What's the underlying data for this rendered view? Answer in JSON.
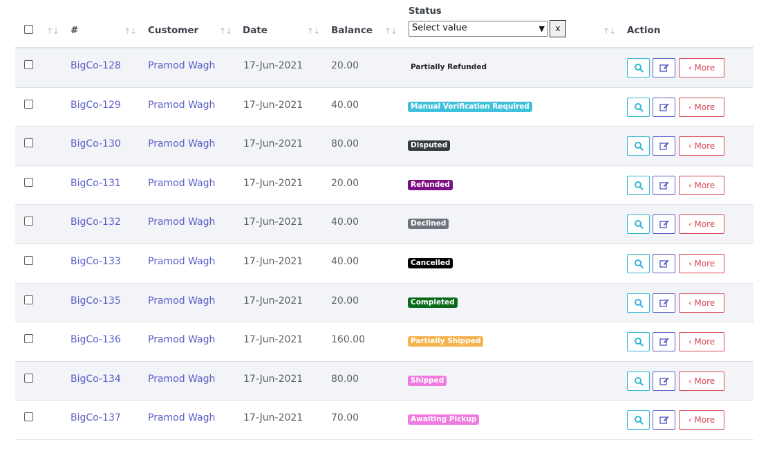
{
  "header": {
    "id_label": "#",
    "customer_label": "Customer",
    "date_label": "Date",
    "balance_label": "Balance",
    "status_label": "Status",
    "action_label": "Action",
    "status_filter_value": "Select value",
    "clear_label": "x",
    "sort_glyph": "↑↓"
  },
  "more_label": "‹ More",
  "rows": [
    {
      "id": "BigCo-128",
      "customer": "Pramod Wagh",
      "date": "17-Jun-2021",
      "balance": "20.00",
      "status": "Partially Refunded"
    },
    {
      "id": "BigCo-129",
      "customer": "Pramod Wagh",
      "date": "17-Jun-2021",
      "balance": "40.00",
      "status": "Manual Verification Required"
    },
    {
      "id": "BigCo-130",
      "customer": "Pramod Wagh",
      "date": "17-Jun-2021",
      "balance": "80.00",
      "status": "Disputed"
    },
    {
      "id": "BigCo-131",
      "customer": "Pramod Wagh",
      "date": "17-Jun-2021",
      "balance": "20.00",
      "status": "Refunded"
    },
    {
      "id": "BigCo-132",
      "customer": "Pramod Wagh",
      "date": "17-Jun-2021",
      "balance": "40.00",
      "status": "Declined"
    },
    {
      "id": "BigCo-133",
      "customer": "Pramod Wagh",
      "date": "17-Jun-2021",
      "balance": "40.00",
      "status": "Cancelled"
    },
    {
      "id": "BigCo-135",
      "customer": "Pramod Wagh",
      "date": "17-Jun-2021",
      "balance": "20.00",
      "status": "Completed"
    },
    {
      "id": "BigCo-136",
      "customer": "Pramod Wagh",
      "date": "17-Jun-2021",
      "balance": "160.00",
      "status": "Partially Shipped"
    },
    {
      "id": "BigCo-134",
      "customer": "Pramod Wagh",
      "date": "17-Jun-2021",
      "balance": "80.00",
      "status": "Shipped"
    },
    {
      "id": "BigCo-137",
      "customer": "Pramod Wagh",
      "date": "17-Jun-2021",
      "balance": "70.00",
      "status": "Awaiting Pickup"
    }
  ],
  "status_colors": {
    "Partially Refunded": {
      "bg": "transparent",
      "fg": "#222222"
    },
    "Manual Verification Required": {
      "bg": "#3fc1db",
      "fg": "#ffffff"
    },
    "Disputed": {
      "bg": "#343a40",
      "fg": "#ffffff"
    },
    "Refunded": {
      "bg": "#7b0e84",
      "fg": "#ffffff"
    },
    "Declined": {
      "bg": "#6c757d",
      "fg": "#ffffff"
    },
    "Cancelled": {
      "bg": "#000000",
      "fg": "#ffffff"
    },
    "Completed": {
      "bg": "#0c6b1b",
      "fg": "#ffffff"
    },
    "Partially Shipped": {
      "bg": "#f5b350",
      "fg": "#ffffff"
    },
    "Shipped": {
      "bg": "#f07be0",
      "fg": "#ffffff"
    },
    "Awaiting Pickup": {
      "bg": "#f07be0",
      "fg": "#ffffff"
    }
  }
}
